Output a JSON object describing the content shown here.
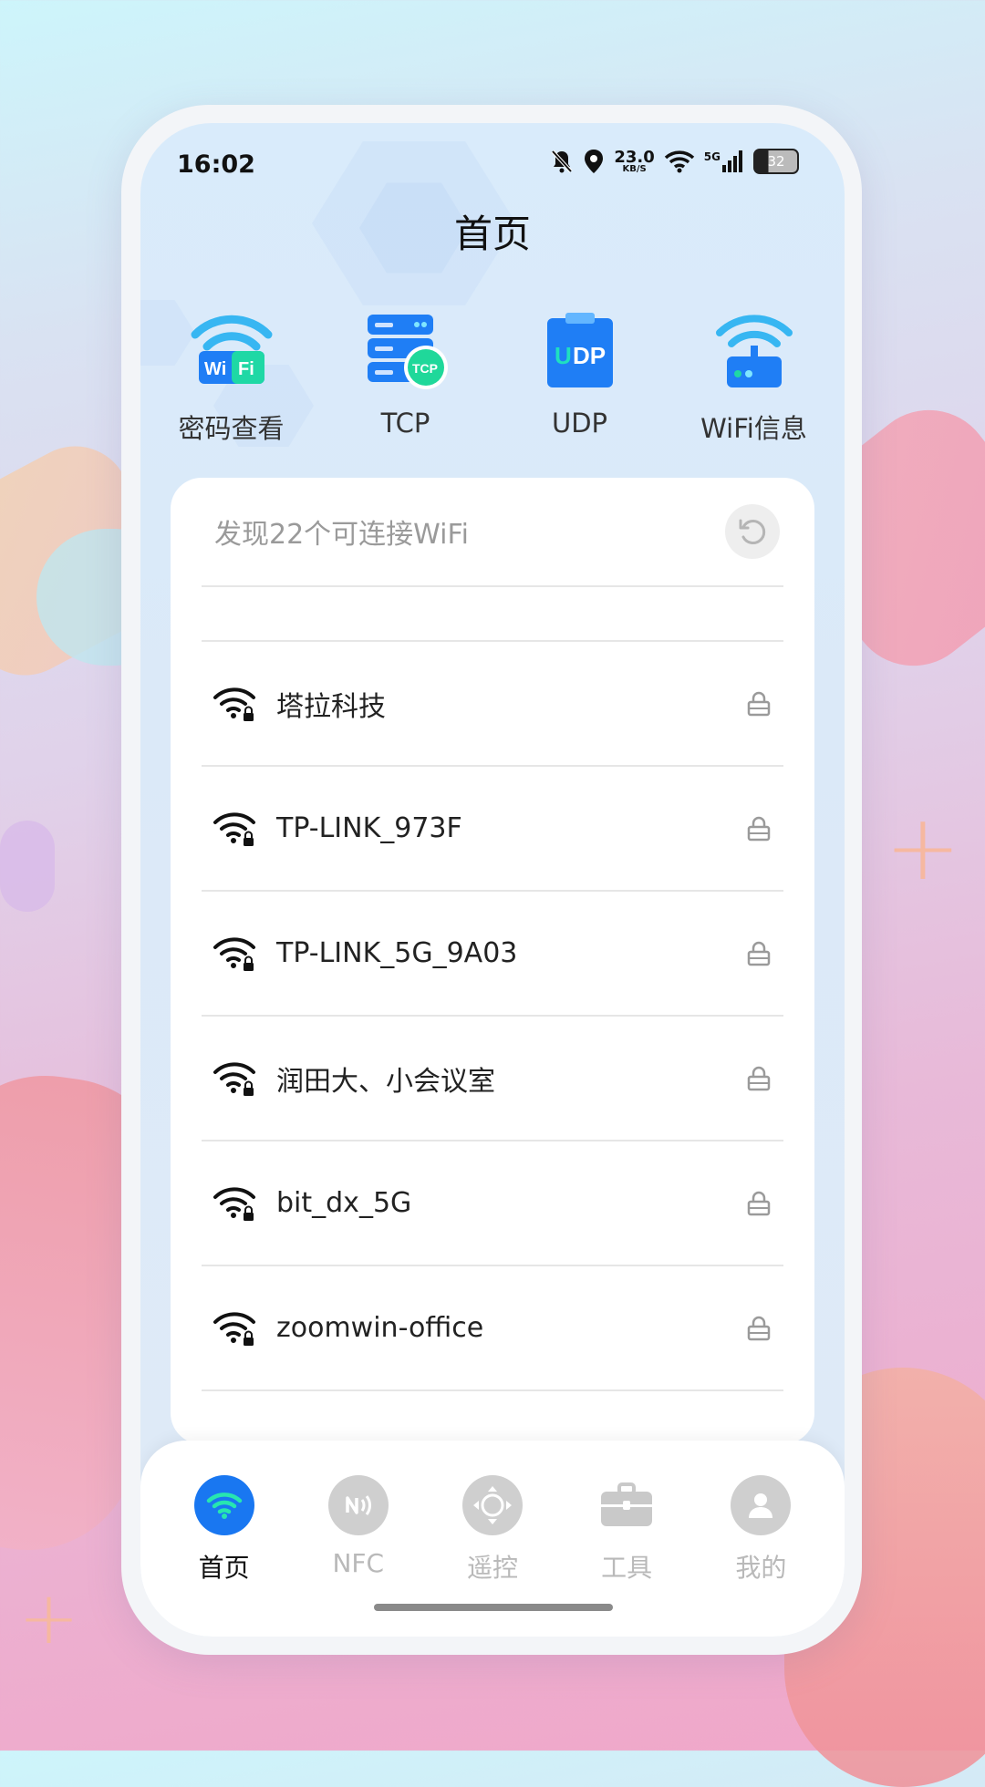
{
  "status": {
    "time": "16:02",
    "net_speed_value": "23.0",
    "net_speed_unit": "KB/S",
    "network_type": "5G",
    "battery": "32",
    "icons": [
      "mute-bell-icon",
      "location-icon",
      "wifi-icon",
      "cell-signal-icon",
      "battery-icon"
    ]
  },
  "header": {
    "title": "首页"
  },
  "quick_actions": [
    {
      "label": "密码查看",
      "icon": "wifi-password-icon"
    },
    {
      "label": "TCP",
      "icon": "tcp-server-icon"
    },
    {
      "label": "UDP",
      "icon": "udp-clipboard-icon"
    },
    {
      "label": "WiFi信息",
      "icon": "router-icon"
    }
  ],
  "wifi_list": {
    "found_text": "发现22个可连接WiFi",
    "networks": [
      {
        "name": "塔拉科技",
        "secured": true
      },
      {
        "name": "TP-LINK_973F",
        "secured": true
      },
      {
        "name": "TP-LINK_5G_9A03",
        "secured": true
      },
      {
        "name": "润田大、小会议室",
        "secured": true
      },
      {
        "name": "bit_dx_5G",
        "secured": true
      },
      {
        "name": "zoomwin-office",
        "secured": true
      }
    ]
  },
  "tabbar": {
    "tabs": [
      {
        "label": "首页",
        "icon": "wifi-icon",
        "active": true
      },
      {
        "label": "NFC",
        "icon": "nfc-icon",
        "active": false
      },
      {
        "label": "遥控",
        "icon": "remote-dpad-icon",
        "active": false
      },
      {
        "label": "工具",
        "icon": "toolbox-icon",
        "active": false
      },
      {
        "label": "我的",
        "icon": "user-icon",
        "active": false
      }
    ]
  },
  "colors": {
    "accent": "#1977f1",
    "tcp_badge": "#1fd89a",
    "inactive": "#cfcfcf"
  }
}
